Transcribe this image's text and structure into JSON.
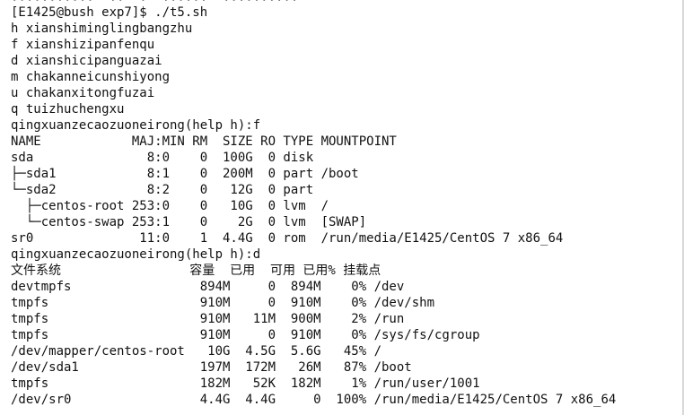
{
  "terminal": {
    "top_fragment": "...........  ..  .  ......  ..........",
    "lines": [
      "[E1425@bush exp7]$ ./t5.sh",
      "h xianshiminglingbangzhu",
      "f xianshizipanfenqu",
      "d xianshicipanguazai",
      "m chakanneicunshiyong",
      "u chakanxitongfuzai",
      "q tuizhuchengxu",
      "qingxuanzecaozuoneirong(help h):f",
      "NAME            MAJ:MIN RM  SIZE RO TYPE MOUNTPOINT",
      "sda               8:0    0  100G  0 disk",
      "├─sda1            8:1    0  200M  0 part /boot",
      "└─sda2            8:2    0   12G  0 part",
      "  ├─centos-root 253:0    0   10G  0 lvm  /",
      "  └─centos-swap 253:1    0    2G  0 lvm  [SWAP]",
      "sr0              11:0    1  4.4G  0 rom  /run/media/E1425/CentOS 7 x86_64",
      "qingxuanzecaozuoneirong(help h):d",
      "文件系统                 容量  已用  可用 已用% 挂载点",
      "devtmpfs                 894M     0  894M    0% /dev",
      "tmpfs                    910M     0  910M    0% /dev/shm",
      "tmpfs                    910M   11M  900M    2% /run",
      "tmpfs                    910M     0  910M    0% /sys/fs/cgroup",
      "/dev/mapper/centos-root   10G  4.5G  5.6G   45% /",
      "/dev/sda1                197M  172M   26M   87% /boot",
      "tmpfs                    182M   52K  182M    1% /run/user/1001",
      "/dev/sr0                 4.4G  4.4G     0  100% /run/media/E1425/CentOS 7 x86_64"
    ]
  }
}
